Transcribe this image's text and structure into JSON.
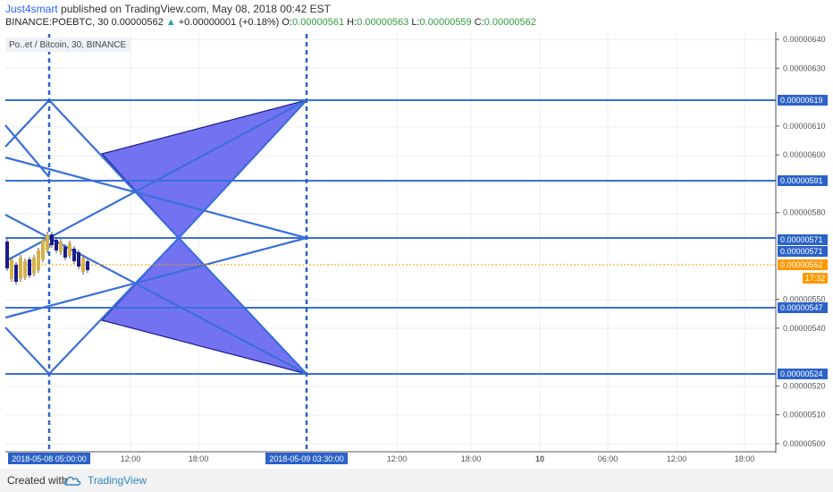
{
  "header": {
    "author": "Just4smart",
    "published_text": "published on TradingView.com, May 08, 2018 00:42 EST",
    "symbol_line": "BINANCE:POEBTC, 30",
    "last": "0.00000562",
    "change": "+0.00000001 (+0.18%)",
    "o_label": "O:",
    "o_value": "0.00000561",
    "h_label": "H:",
    "h_value": "0.00000563",
    "l_label": "L:",
    "l_value": "0.00000559",
    "c_label": "C:",
    "c_value": "0.00000562"
  },
  "legend": {
    "text": "Po..et / Bitcoin, 30, BINANCE"
  },
  "footer": {
    "created_with": "Created with",
    "brand": "TradingView"
  },
  "colors": {
    "line": "#3a6fd8",
    "fill": "#5b5bf0",
    "label_bg": "#2a62c9",
    "last_price": "#ff9800",
    "candle_up": "#d4b24a",
    "candle_down": "#1a1a8c"
  },
  "chart_data": {
    "type": "line",
    "x_axis_labels": [
      "2018-05-08 05:00:00",
      "12:00",
      "18:00",
      "2018-05-09 03:30:00",
      "12:00",
      "18:00",
      "10",
      "06:00",
      "12:00",
      "18:00"
    ],
    "y_ticks": [
      "0.00000640",
      "0.00000630",
      "0.00000610",
      "0.00000600",
      "0.00000580",
      "0.00000550",
      "0.00000540",
      "0.00000520",
      "0.00000510",
      "0.00000500"
    ],
    "ylim": [
      5e-06,
      6.45e-06
    ],
    "horizontal_levels": [
      "0.00000619",
      "0.00000591",
      "0.00000571",
      "0.00000547",
      "0.00000524"
    ],
    "price_tags": [
      "0.00000619",
      "0.00000591",
      "0.00000571",
      "0.00000571",
      "0.00000562",
      "0.00000547",
      "0.00000524"
    ],
    "last_price": "0.00000562",
    "countdown": "17:32",
    "time_markers": [
      "2018-05-08 05:00:00",
      "2018-05-09 03:30:00"
    ]
  }
}
